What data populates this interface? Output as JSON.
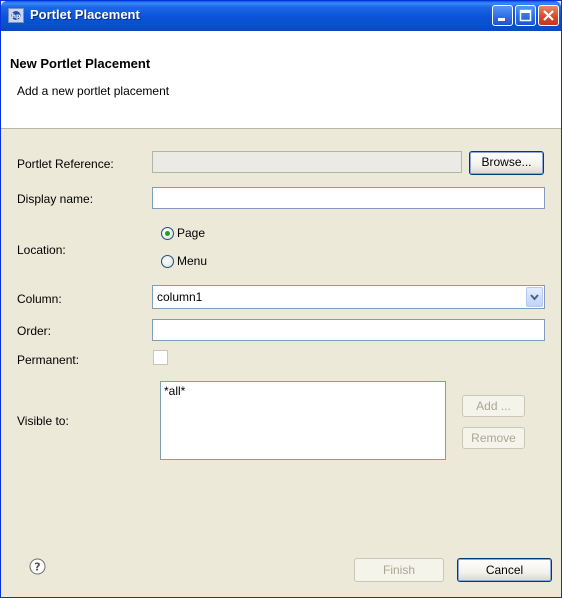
{
  "window": {
    "title": "Portlet Placement"
  },
  "header": {
    "title": "New Portlet Placement",
    "description": "Add a new portlet placement"
  },
  "form": {
    "portlet_reference": {
      "label": "Portlet Reference:",
      "value": "",
      "browse_label": "Browse..."
    },
    "display_name": {
      "label": "Display name:",
      "value": ""
    },
    "location": {
      "label": "Location:",
      "options": [
        {
          "label": "Page",
          "selected": true
        },
        {
          "label": "Menu",
          "selected": false
        }
      ]
    },
    "column": {
      "label": "Column:",
      "value": "column1"
    },
    "order": {
      "label": "Order:",
      "value": ""
    },
    "permanent": {
      "label": "Permanent:",
      "checked": false
    },
    "visible_to": {
      "label": "Visible to:",
      "items": [
        "*all*"
      ],
      "add_label": "Add ...",
      "remove_label": "Remove"
    }
  },
  "footer": {
    "finish_label": "Finish",
    "cancel_label": "Cancel",
    "help_icon": "help-icon"
  },
  "colors": {
    "titlebar": "#0a53d8",
    "dialog_bg": "#ece9d8",
    "radio_selected": "#21a121"
  }
}
